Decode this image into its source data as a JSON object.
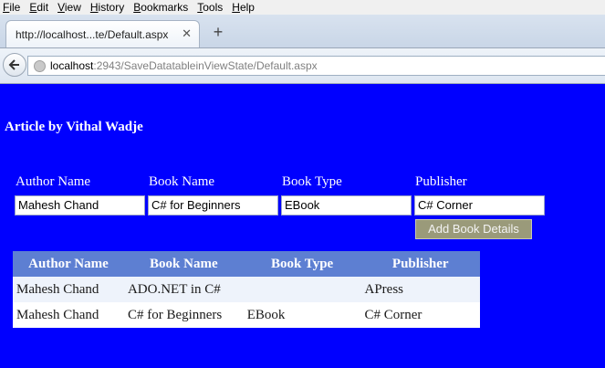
{
  "browser": {
    "menu": [
      "File",
      "Edit",
      "View",
      "History",
      "Bookmarks",
      "Tools",
      "Help"
    ],
    "tab_title": "http://localhost...te/Default.aspx",
    "url_host": "localhost",
    "url_rest": ":2943/SaveDatatableinViewState/Default.aspx"
  },
  "page": {
    "title": "Article by Vithal Wadje",
    "form": {
      "author_label": "Author Name",
      "book_label": "Book Name",
      "type_label": "Book Type",
      "publisher_label": "Publisher",
      "author_value": "Mahesh  Chand",
      "book_value": "C# for Beginners",
      "type_value": "EBook",
      "publisher_value": "C# Corner",
      "add_button": "Add Book Details"
    },
    "grid": {
      "headers": [
        "Author Name",
        "Book Name",
        "Book Type",
        "Publisher"
      ],
      "rows": [
        [
          "Mahesh Chand",
          "ADO.NET in C#",
          "",
          "APress"
        ],
        [
          "Mahesh Chand",
          "C# for Beginners",
          "EBook",
          "C# Corner"
        ]
      ]
    }
  }
}
